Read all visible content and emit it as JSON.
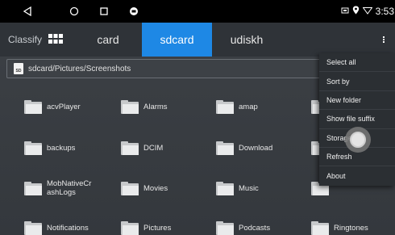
{
  "status": {
    "icons": [
      "back-triangle-icon",
      "home-circle-icon",
      "recents-square-icon",
      "screenshot-icon"
    ],
    "right_icons": [
      "sim-icon",
      "location-icon",
      "wifi-icon"
    ],
    "time": "3:53"
  },
  "tabbar": {
    "classify_label": "Classify",
    "tabs": [
      {
        "label": "card"
      },
      {
        "label": "sdcard"
      },
      {
        "label": "udiskh"
      }
    ],
    "active_tab": "sdcard"
  },
  "path": {
    "icon_text": "SD",
    "value": "sdcard/Pictures/Screenshots"
  },
  "folders": [
    {
      "name": "acvPlayer"
    },
    {
      "name": "Alarms"
    },
    {
      "name": "amap"
    },
    {
      "name": ""
    },
    {
      "name": "backups"
    },
    {
      "name": "DCIM"
    },
    {
      "name": "Download"
    },
    {
      "name": ""
    },
    {
      "name": "MobNativeCrashLogs"
    },
    {
      "name": "Movies"
    },
    {
      "name": "Music"
    },
    {
      "name": ""
    },
    {
      "name": "Notifications"
    },
    {
      "name": "Pictures"
    },
    {
      "name": "Podcasts"
    },
    {
      "name": "Ringtones"
    }
  ],
  "menu": {
    "items": [
      {
        "label": "Select all"
      },
      {
        "label": "Sort by"
      },
      {
        "label": "New folder"
      },
      {
        "label": "Show file suffix"
      },
      {
        "label": "Storage info"
      },
      {
        "label": "Refresh"
      },
      {
        "label": "About"
      }
    ]
  },
  "colors": {
    "accent": "#1e88e5",
    "tabbar_bg": "#2f3338",
    "content_bg": "#3b3f44",
    "menu_bg": "#2b2f33"
  }
}
